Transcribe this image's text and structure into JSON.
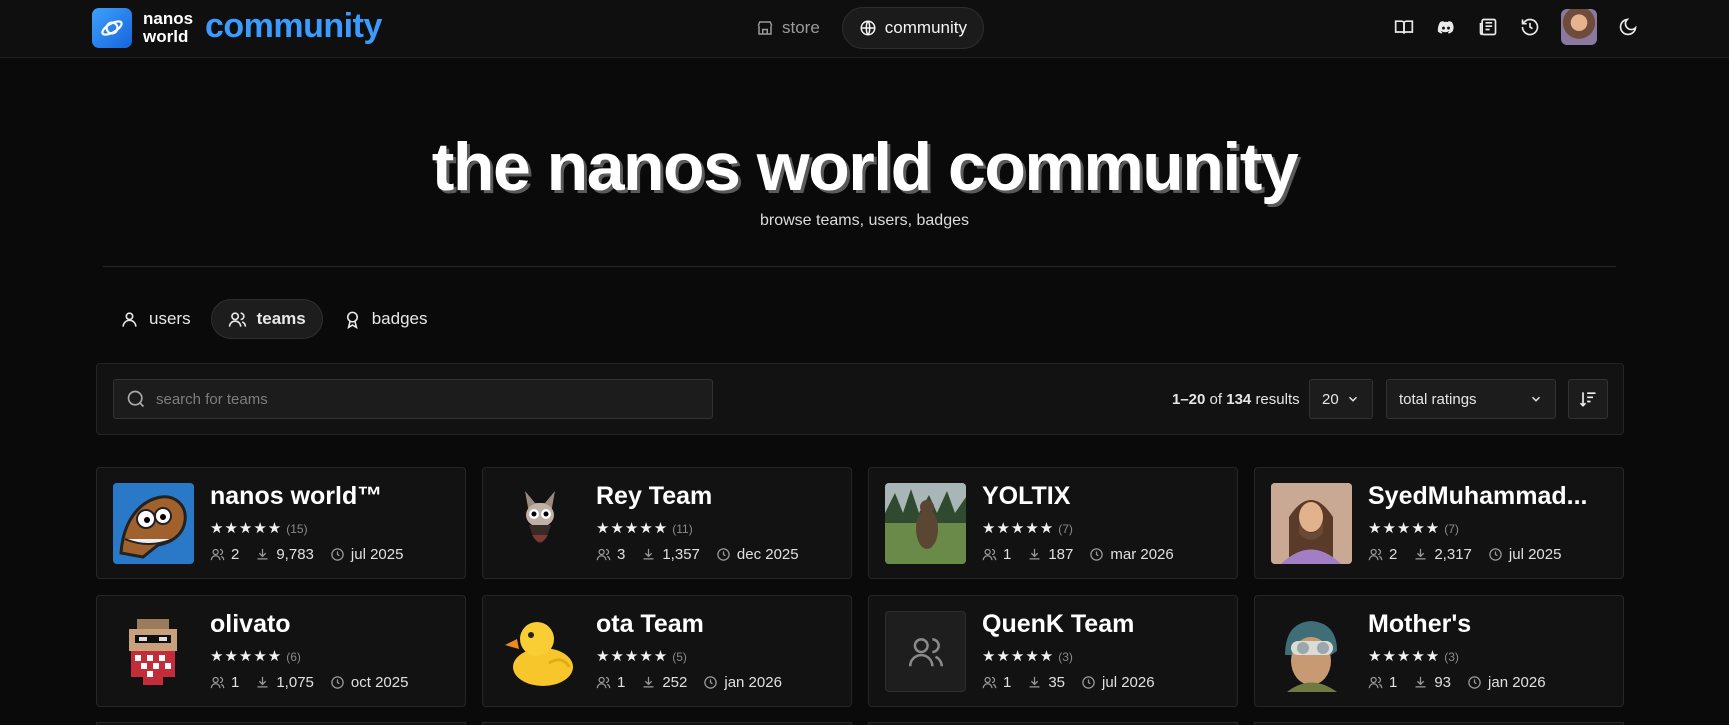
{
  "brand": {
    "logo_line1": "nanos",
    "logo_line2": "world",
    "product": "community"
  },
  "nav": {
    "store": "store",
    "community": "community"
  },
  "hero": {
    "title": "the nanos world community",
    "subtitle": "browse teams, users, badges"
  },
  "tabs": [
    {
      "label": "users"
    },
    {
      "label": "teams"
    },
    {
      "label": "badges"
    }
  ],
  "search": {
    "placeholder": "search for teams"
  },
  "results": {
    "range": "1–20",
    "of": "of",
    "total": "134",
    "suffix": "results"
  },
  "per_page": "20",
  "sort_by": "total ratings",
  "cards": [
    {
      "name": "nanos world™",
      "stars": "★★★★★",
      "ratings": "(15)",
      "members": "2",
      "downloads": "9,783",
      "date": "jul 2025"
    },
    {
      "name": "Rey Team",
      "stars": "★★★★★",
      "ratings": "(11)",
      "members": "3",
      "downloads": "1,357",
      "date": "dec 2025"
    },
    {
      "name": "YOLTIX",
      "stars": "★★★★★",
      "ratings": "(7)",
      "members": "1",
      "downloads": "187",
      "date": "mar 2026"
    },
    {
      "name": "SyedMuhammad...",
      "stars": "★★★★★",
      "ratings": "(7)",
      "members": "2",
      "downloads": "2,317",
      "date": "jul 2025"
    },
    {
      "name": "olivato",
      "stars": "★★★★★",
      "ratings": "(6)",
      "members": "1",
      "downloads": "1,075",
      "date": "oct 2025"
    },
    {
      "name": "ota Team",
      "stars": "★★★★★",
      "ratings": "(5)",
      "members": "1",
      "downloads": "252",
      "date": "jan 2026"
    },
    {
      "name": "QuenK Team",
      "stars": "★★★★★",
      "ratings": "(3)",
      "members": "1",
      "downloads": "35",
      "date": "jul 2026"
    },
    {
      "name": "Mother's",
      "stars": "★★★★★",
      "ratings": "(3)",
      "members": "1",
      "downloads": "93",
      "date": "jan 2026"
    }
  ],
  "colors": {
    "accent": "#3b9bff",
    "background": "#0a0a0a",
    "card": "#121212"
  }
}
